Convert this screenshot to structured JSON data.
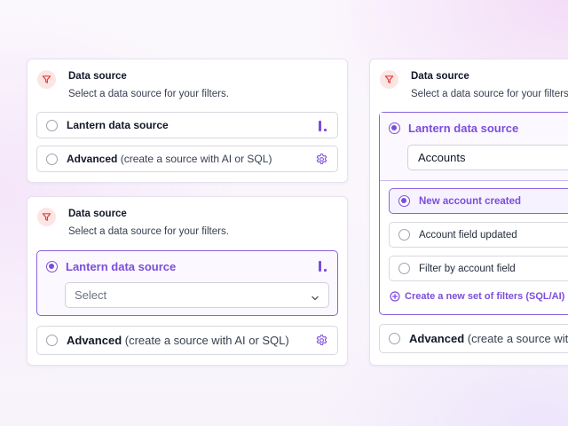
{
  "colors": {
    "accent": "#7c4ddb",
    "filter_icon": "#e0413f",
    "filter_badge_bg": "#fde5e4"
  },
  "card1": {
    "title": "Data source",
    "subtitle": "Select a data source for your filters.",
    "lantern_label": "Lantern data source",
    "advanced_label": "Advanced",
    "advanced_hint": "(create a source with AI or SQL)"
  },
  "card2": {
    "title": "Data source",
    "subtitle": "Select a data source for your filters.",
    "lantern_label": "Lantern data source",
    "select_placeholder": "Select",
    "advanced_label": "Advanced",
    "advanced_hint": "(create a source with AI or SQL)"
  },
  "card3": {
    "title": "Data source",
    "subtitle": "Select a data source for your filters.",
    "lantern_label": "Lantern data source",
    "select_value": "Accounts",
    "filter_options": [
      {
        "label": "New account created",
        "selected": true
      },
      {
        "label": "Account field updated",
        "selected": false
      },
      {
        "label": "Filter by account field",
        "selected": false
      }
    ],
    "create_link": "Create a new set of filters (SQL/AI)",
    "advanced_label": "Advanced",
    "advanced_hint": "(create a source with AI or SQL)"
  }
}
